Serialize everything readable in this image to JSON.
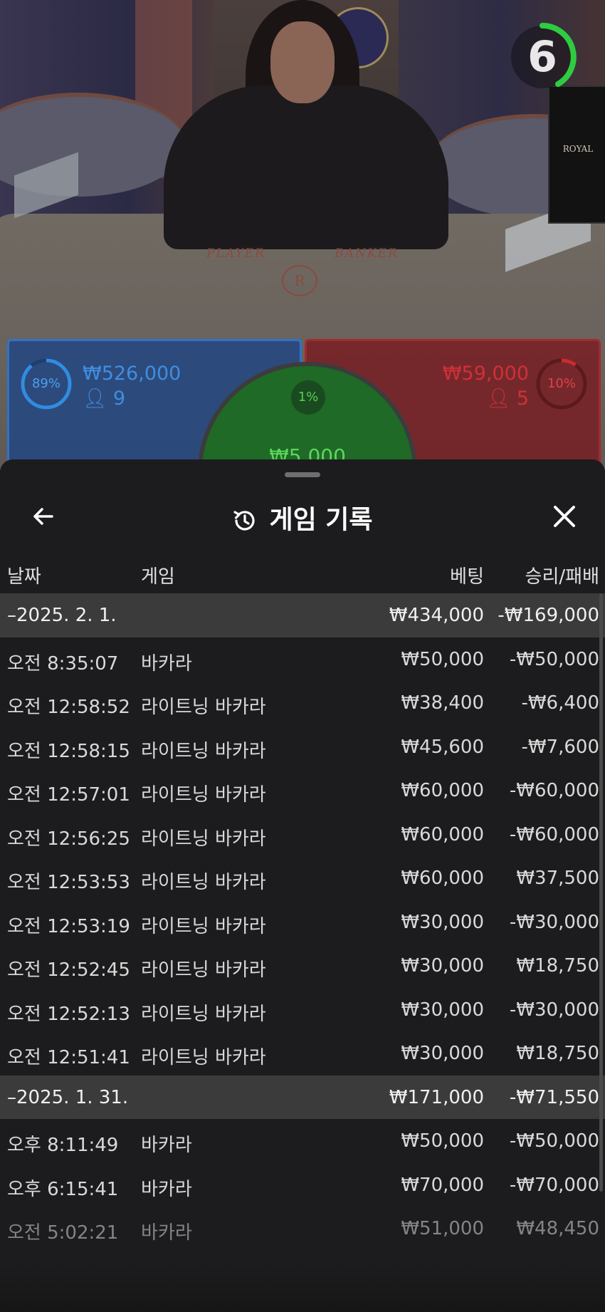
{
  "stage": {
    "table_labels": {
      "player": "PLAYER",
      "banker": "BANKER"
    },
    "emblem_letter": "R",
    "tournament_label": "ROYAL",
    "timer": {
      "value": "6",
      "color": "#2ecc40"
    },
    "player": {
      "percent": "89%",
      "amount": "₩526,000",
      "count": "9",
      "color": "#2f74c6"
    },
    "banker": {
      "percent": "10%",
      "amount": "₩59,000",
      "count": "5",
      "color": "#c0282e"
    },
    "tie": {
      "percent": "1%",
      "amount": "₩5,000",
      "color": "#3cc43c"
    }
  },
  "sheet": {
    "title": "게임 기록",
    "back_icon": "arrow-left-icon",
    "history_icon": "history-icon",
    "close_icon": "close-icon",
    "columns": {
      "date": "날짜",
      "game": "게임",
      "bet": "베팅",
      "win_loss": "승리/패배"
    },
    "rows": [
      {
        "type": "group",
        "date": "–2025. 2. 1.",
        "game": "",
        "bet": "₩434,000",
        "win_loss": "-₩169,000"
      },
      {
        "type": "item",
        "date": "오전 8:35:07",
        "game": "바카라",
        "bet": "₩50,000",
        "win_loss": "-₩50,000"
      },
      {
        "type": "item",
        "date": "오전 12:58:52",
        "game": "라이트닝 바카라",
        "bet": "₩38,400",
        "win_loss": "-₩6,400"
      },
      {
        "type": "item",
        "date": "오전 12:58:15",
        "game": "라이트닝 바카라",
        "bet": "₩45,600",
        "win_loss": "-₩7,600"
      },
      {
        "type": "item",
        "date": "오전 12:57:01",
        "game": "라이트닝 바카라",
        "bet": "₩60,000",
        "win_loss": "-₩60,000"
      },
      {
        "type": "item",
        "date": "오전 12:56:25",
        "game": "라이트닝 바카라",
        "bet": "₩60,000",
        "win_loss": "-₩60,000"
      },
      {
        "type": "item",
        "date": "오전 12:53:53",
        "game": "라이트닝 바카라",
        "bet": "₩60,000",
        "win_loss": "₩37,500"
      },
      {
        "type": "item",
        "date": "오전 12:53:19",
        "game": "라이트닝 바카라",
        "bet": "₩30,000",
        "win_loss": "-₩30,000"
      },
      {
        "type": "item",
        "date": "오전 12:52:45",
        "game": "라이트닝 바카라",
        "bet": "₩30,000",
        "win_loss": "₩18,750"
      },
      {
        "type": "item",
        "date": "오전 12:52:13",
        "game": "라이트닝 바카라",
        "bet": "₩30,000",
        "win_loss": "-₩30,000"
      },
      {
        "type": "item",
        "date": "오전 12:51:41",
        "game": "라이트닝 바카라",
        "bet": "₩30,000",
        "win_loss": "₩18,750"
      },
      {
        "type": "group",
        "date": "–2025. 1. 31.",
        "game": "",
        "bet": "₩171,000",
        "win_loss": "-₩71,550"
      },
      {
        "type": "item",
        "date": "오후 8:11:49",
        "game": "바카라",
        "bet": "₩50,000",
        "win_loss": "-₩50,000"
      },
      {
        "type": "item",
        "date": "오후 6:15:41",
        "game": "바카라",
        "bet": "₩70,000",
        "win_loss": "-₩70,000"
      },
      {
        "type": "item",
        "date": "오전 5:02:21",
        "game": "바카라",
        "bet": "₩51,000",
        "win_loss": "₩48,450"
      }
    ]
  }
}
